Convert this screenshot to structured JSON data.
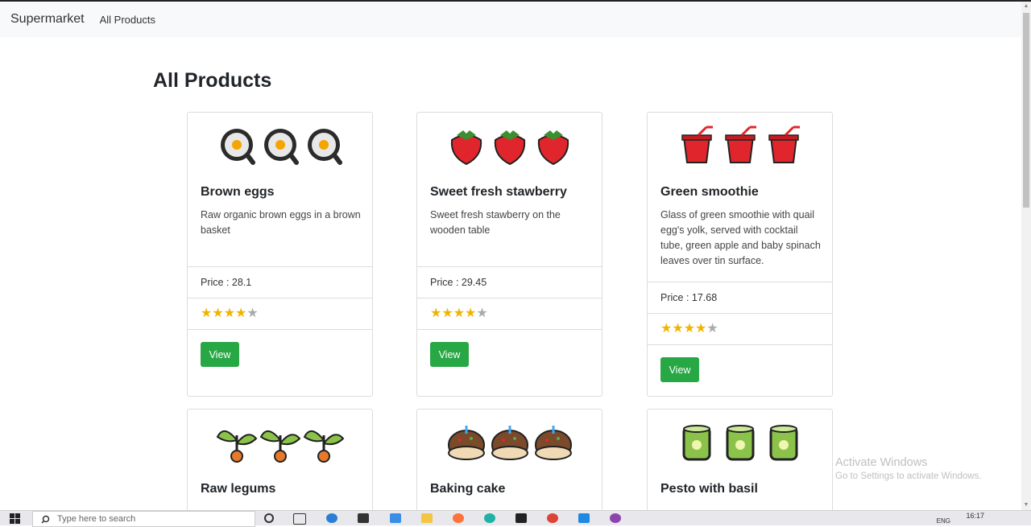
{
  "navbar": {
    "brand": "Supermarket",
    "link": "All Products"
  },
  "page": {
    "title": "All Products"
  },
  "products": [
    {
      "name": "Brown eggs",
      "description": "Raw organic brown eggs in a brown basket",
      "price_text": "Price : 28.1",
      "rating": 4,
      "emoji": "🍳",
      "button": "View"
    },
    {
      "name": "Sweet fresh stawberry",
      "description": "Sweet fresh stawberry on the wooden table",
      "price_text": "Price : 29.45",
      "rating": 4,
      "emoji": "🍓",
      "button": "View"
    },
    {
      "name": "Green smoothie",
      "description": "Glass of green smoothie with quail egg's yolk, served with cocktail tube, green apple and baby spinach leaves over tin surface.",
      "price_text": "Price : 17.68",
      "rating": 4,
      "emoji": "🥤",
      "button": "View"
    },
    {
      "name": "Raw legums",
      "emoji": "🌱"
    },
    {
      "name": "Baking cake",
      "emoji": "🎂"
    },
    {
      "name": "Pesto with basil",
      "emoji": "🥫"
    }
  ],
  "watermark": {
    "line1": "Activate Windows",
    "line2": "Go to Settings to activate Windows."
  },
  "taskbar": {
    "search_placeholder": "Type here to search",
    "language": "ENG",
    "time": "16:17"
  }
}
